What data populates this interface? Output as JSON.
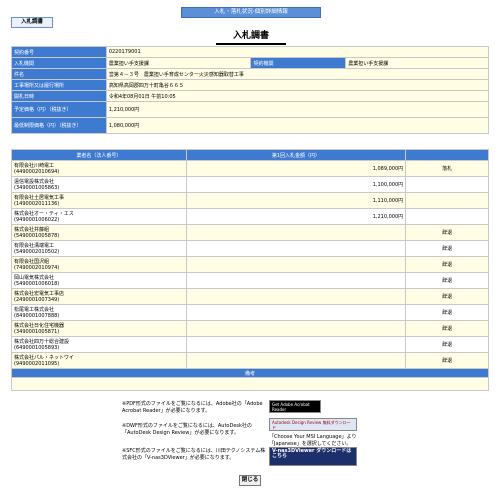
{
  "header": {
    "banner": "入札・落札状況-個別詳細情報",
    "tab_label": "入札調書",
    "page_title": "入札調書"
  },
  "info": {
    "contract_no_label": "契約番号",
    "contract_no": "0220179001",
    "dept_label": "入札機関",
    "dept": "農業担い手支援課",
    "contract_dept_label": "契約機関",
    "contract_dept": "農業担い手支援課",
    "item_label": "件名",
    "item": "営第４－３号　農業担い手育成センター火災感知器取替工事",
    "place_label": "工事場所又は履行場所",
    "place": "高知県高岡郡四万十町亀谷６６５",
    "date_label": "開札日時",
    "date": "令和4年08月01日 午前10:05",
    "budget_label": "予定価格（円）（税抜き）",
    "budget": "1,210,000円",
    "min_label": "最低制限価格（円）（税抜き）",
    "min_price": "1,080,000円"
  },
  "bids": {
    "col_name": "業者名（法人番号）",
    "col_amount": "第1回入札金額（円）",
    "col_result": "",
    "rows": [
      {
        "name": "有限会社川崎電工",
        "id": "(4490002010694)",
        "amount": "1,089,000円",
        "result": "落札"
      },
      {
        "name": "遠信電設株式会社",
        "id": "(3490001005863)",
        "amount": "1,100,000円",
        "result": ""
      },
      {
        "name": "有限会社土居電気工事",
        "id": "(1490002011136)",
        "amount": "1,110,000円",
        "result": ""
      },
      {
        "name": "株式会社オー・ティ・エス",
        "id": "(9490001006022)",
        "amount": "1,210,000円",
        "result": ""
      },
      {
        "name": "株式会社井藤組",
        "id": "(5490001005878)",
        "amount": "",
        "result": "辞退"
      },
      {
        "name": "有限会社溝端電工",
        "id": "(5490002010502)",
        "amount": "",
        "result": "辞退"
      },
      {
        "name": "有限会社国沢組",
        "id": "(7490002010974)",
        "amount": "",
        "result": "辞退"
      },
      {
        "name": "岡山電気株式会社",
        "id": "(5490001006018)",
        "amount": "",
        "result": "辞退"
      },
      {
        "name": "株式会社宏電気工事店",
        "id": "(2490001007349)",
        "amount": "",
        "result": "辞退"
      },
      {
        "name": "松尾電工株式会社",
        "id": "(8490001007888)",
        "amount": "",
        "result": "辞退"
      },
      {
        "name": "株式会社日化住宅機器",
        "id": "(3490001005871)",
        "amount": "",
        "result": "辞退"
      },
      {
        "name": "株式会社四万十総合建設",
        "id": "(6490001005893)",
        "amount": "",
        "result": "辞退"
      },
      {
        "name": "株式会社パル・ネットワイ",
        "id": "(9490002011095)",
        "amount": "",
        "result": "辞退"
      }
    ]
  },
  "remarks": {
    "label": "備考",
    "value": ""
  },
  "notes": {
    "pdf": "※PDF形式のファイルをご覧になるには、Adobe社の「Adobe Acrobat Reader」が必要になります。",
    "dwf": "※DWF形式のファイルをご覧になるには、AutoDesk社の「AutoDesk Design Review」が必要になります。",
    "sfc": "※SFC形式のファイルをご覧になるには、川田テクノシステム株式会社の「V-nas3DViewer」が必要になります。",
    "pdf_badge": "Get Adobe Acrobat Reader",
    "dwf_badge": "Autodesk Design Review 無料ダウンロード",
    "dwf_tip": "「Choose Your MSI Language」より「Japanese」を選択してください。",
    "sfc_badge": "V-nas3DViewer ダウンロードはこちら"
  },
  "close_label": "閉じる"
}
